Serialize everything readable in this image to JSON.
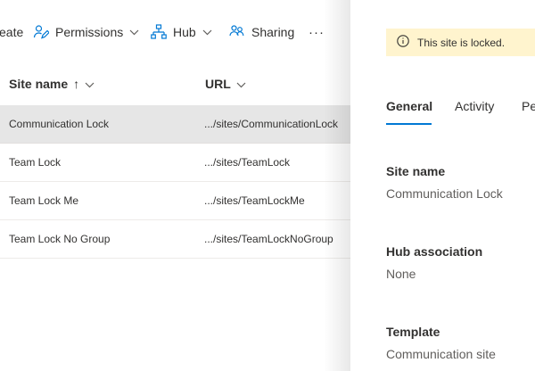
{
  "toolbar": {
    "create_label": "eate",
    "permissions_label": "Permissions",
    "hub_label": "Hub",
    "sharing_label": "Sharing",
    "more_label": "···"
  },
  "table": {
    "columns": [
      {
        "label": "Site name",
        "sort": "↑"
      },
      {
        "label": "URL"
      }
    ],
    "rows": [
      {
        "name": "Communication Lock",
        "url": ".../sites/CommunicationLock",
        "selected": true
      },
      {
        "name": "Team Lock",
        "url": ".../sites/TeamLock"
      },
      {
        "name": "Team Lock Me",
        "url": ".../sites/TeamLockMe"
      },
      {
        "name": "Team Lock No Group",
        "url": ".../sites/TeamLockNoGroup"
      }
    ]
  },
  "panel": {
    "locked_message": "This site is locked.",
    "tabs": [
      {
        "label": "General",
        "active": true
      },
      {
        "label": "Activity"
      },
      {
        "label": "Pe"
      }
    ],
    "fields": [
      {
        "label": "Site name",
        "value": "Communication Lock"
      },
      {
        "label": "Hub association",
        "value": "None"
      },
      {
        "label": "Template",
        "value": "Communication site"
      }
    ]
  },
  "colors": {
    "accent": "#0078d4",
    "icon": "#0078d4",
    "locked_bg": "#fff4ce",
    "selected_row": "#e6e6e6"
  }
}
